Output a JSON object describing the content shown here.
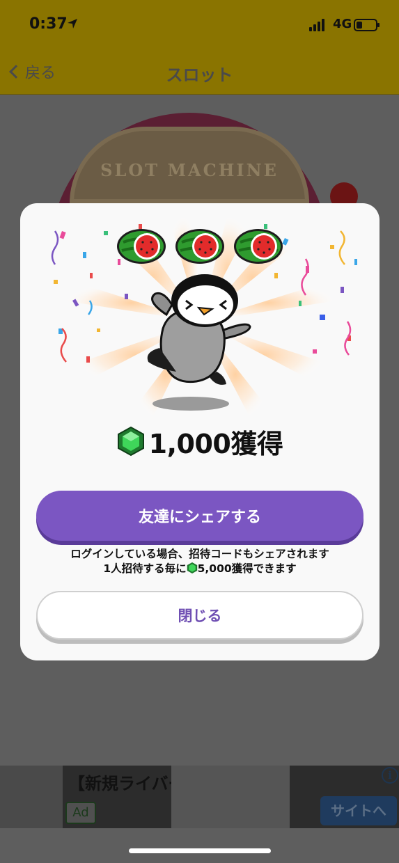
{
  "status_bar": {
    "time": "0:37",
    "network": "4G",
    "location_icon": "location-arrow-icon",
    "signal_icon": "cell-signal-icon",
    "battery_icon": "battery-icon",
    "battery_level": 0.3
  },
  "nav": {
    "back_label": "戻る",
    "title": "スロット"
  },
  "machine": {
    "sign_text": "SLOT MACHINE"
  },
  "modal": {
    "reels": [
      "watermelon",
      "watermelon",
      "watermelon"
    ],
    "mascot": "penguin",
    "reward_icon": "green-gem-icon",
    "reward_text": "1,000獲得",
    "share_button": "友達にシェアする",
    "note_line1": "ログインしている場合、招待コードもシェアされます",
    "note_line2_prefix": "1人招待する毎に",
    "note_line2_suffix": "5,000獲得できます",
    "close_button": "閉じる"
  },
  "ad": {
    "title": "【新規ライバー募集】",
    "badge": "Ad",
    "cta": "サイトへ",
    "info_icon": "info-icon"
  },
  "colors": {
    "accent_purple": "#7b56c2",
    "gem_green": "#2fb84a",
    "nav_yellow_dimmed": "#8a7400"
  }
}
